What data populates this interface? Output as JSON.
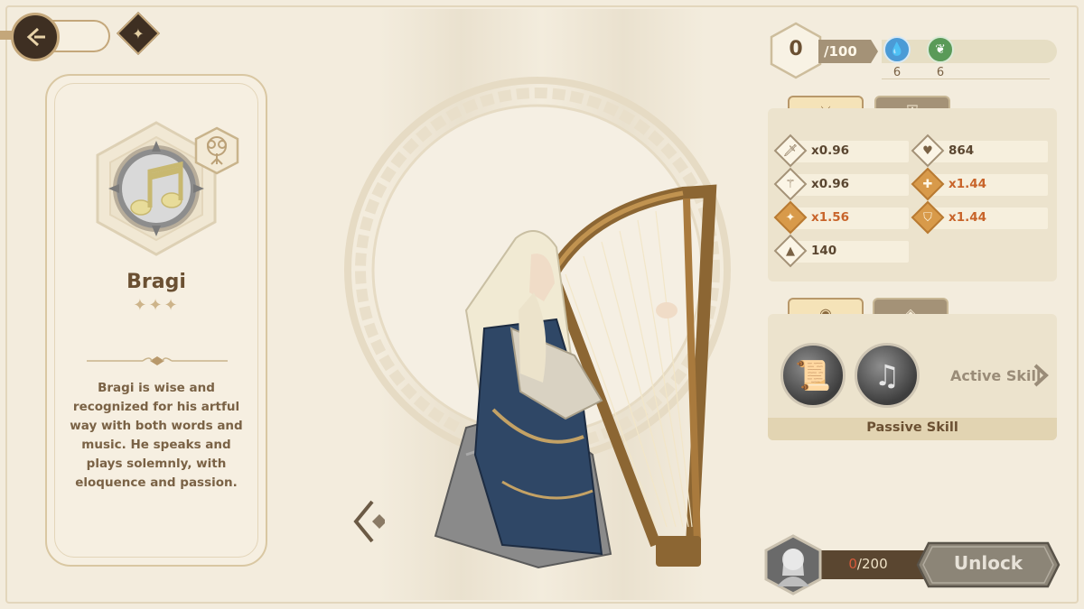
{
  "nav": {
    "back_icon": "back-arrow-icon",
    "compass_icon": "compass-icon"
  },
  "hero": {
    "name": "Bragi",
    "stars": "✦✦✦",
    "class_icon": "music-notes-icon",
    "faction_icon": "tree-icon",
    "description": "Bragi is wise and recognized for his artful way with both words and music. He speaks and plays solemnly, with eloquence and passion."
  },
  "resources": {
    "energy_value": "0",
    "energy_max": "/100",
    "water_count": "6",
    "leaf_count": "6",
    "water_color": "#4b9bd6",
    "leaf_color": "#5a9a58"
  },
  "stat_tabs": {
    "attack_icon": "crossed-tools-icon",
    "defense_icon": "shield-icon"
  },
  "stats": [
    {
      "icon": "sword-icon",
      "value": "x0.96",
      "highlight": false
    },
    {
      "icon": "heart-icon",
      "value": "864",
      "highlight": false
    },
    {
      "icon": "staff-icon",
      "value": "x0.96",
      "highlight": false
    },
    {
      "icon": "plus-heal-icon",
      "value": "x1.44",
      "highlight": true
    },
    {
      "icon": "magic-sword-icon",
      "value": "x1.56",
      "highlight": true
    },
    {
      "icon": "magic-shield-icon",
      "value": "x1.44",
      "highlight": true
    },
    {
      "icon": "speed-boot-icon",
      "value": "140",
      "highlight": false
    }
  ],
  "skill_tabs": {
    "skill_icon": "circle-dot-icon",
    "rune_icon": "rune-diamond-icon"
  },
  "skills": {
    "skill1_icon": "scroll-icon",
    "skill2_icon": "music-note-icon",
    "active_label": "Active Skill",
    "passive_label": "Passive Skill"
  },
  "unlock": {
    "shard_current": "0",
    "shard_total": "/200",
    "button_label": "Unlock"
  },
  "colors": {
    "accent": "#c4a77a",
    "highlight": "#c8642a",
    "background": "#f3ecdd"
  }
}
